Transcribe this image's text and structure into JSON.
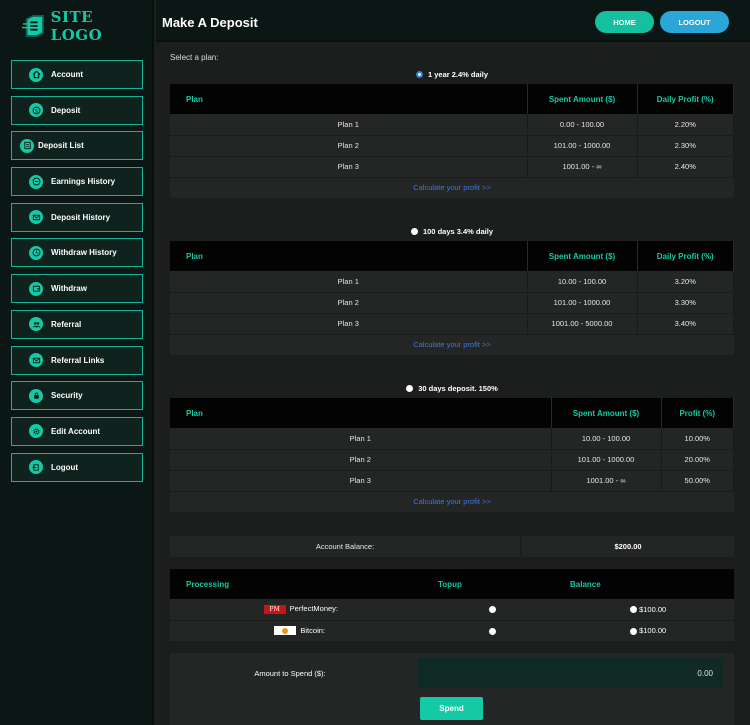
{
  "brand": {
    "logo_text": "SITE LOGO",
    "accent": "#14c9a6"
  },
  "header": {
    "title": "Make A Deposit",
    "home_label": "HOME",
    "logout_label": "LOGOUT"
  },
  "sidebar": {
    "items": [
      {
        "label": "Account",
        "icon": "home-icon"
      },
      {
        "label": "Deposit",
        "icon": "dollar-icon"
      },
      {
        "label": "Deposit List",
        "icon": "list-icon"
      },
      {
        "label": "Earnings History",
        "icon": "money-icon"
      },
      {
        "label": "Deposit History",
        "icon": "mail-icon"
      },
      {
        "label": "Withdraw History",
        "icon": "history-icon"
      },
      {
        "label": "Withdraw",
        "icon": "wallet-icon"
      },
      {
        "label": "Referral",
        "icon": "users-icon"
      },
      {
        "label": "Referral Links",
        "icon": "link-icon"
      },
      {
        "label": "Security",
        "icon": "lock-icon"
      },
      {
        "label": "Edit Account",
        "icon": "gear-icon"
      },
      {
        "label": "Logout",
        "icon": "logout-icon"
      }
    ]
  },
  "main": {
    "select_plan_label": "Select a plan:",
    "plans": [
      {
        "name": "1 year 2.4% daily",
        "selected": true,
        "headers": [
          "Plan",
          "Spent Amount ($)",
          "Daily Profit (%)"
        ],
        "rows": [
          [
            "Plan 1",
            "0.00 - 100.00",
            "2.20%"
          ],
          [
            "Plan 2",
            "101.00 - 1000.00",
            "2.30%"
          ],
          [
            "Plan 3",
            "1001.00 - ∞",
            "2.40%"
          ]
        ],
        "calc_label": "Calculate your profit >>"
      },
      {
        "name": "100 days 3.4% daily",
        "selected": false,
        "headers": [
          "Plan",
          "Spent Amount ($)",
          "Daily Profit (%)"
        ],
        "rows": [
          [
            "Plan 1",
            "10.00 - 100.00",
            "3.20%"
          ],
          [
            "Plan 2",
            "101.00 - 1000.00",
            "3.30%"
          ],
          [
            "Plan 3",
            "1001.00 - 5000.00",
            "3.40%"
          ]
        ],
        "calc_label": "Calculate your profit >>"
      },
      {
        "name": "30 days deposit. 150%",
        "selected": false,
        "headers": [
          "Plan",
          "Spent Amount ($)",
          "Profit (%)"
        ],
        "rows": [
          [
            "Plan 1",
            "10.00 - 100.00",
            "10.00%"
          ],
          [
            "Plan 2",
            "101.00 - 1000.00",
            "20.00%"
          ],
          [
            "Plan 3",
            "1001.00 - ∞",
            "50.00%"
          ]
        ],
        "calc_label": "Calculate your profit >>"
      }
    ],
    "balance": {
      "label": "Account Balance:",
      "value": "$200.00"
    },
    "processing": {
      "headers": [
        "Processing",
        "Topup",
        "Balance"
      ],
      "rows": [
        {
          "name": "PerfectMoney:",
          "badge": "PM",
          "balance": "$100.00"
        },
        {
          "name": "Bitcoin:",
          "badge": "btc",
          "balance": "$100.00"
        }
      ]
    },
    "amount": {
      "label": "Amount to Spend ($):",
      "value": "0.00"
    },
    "spend_label": "Spend"
  }
}
